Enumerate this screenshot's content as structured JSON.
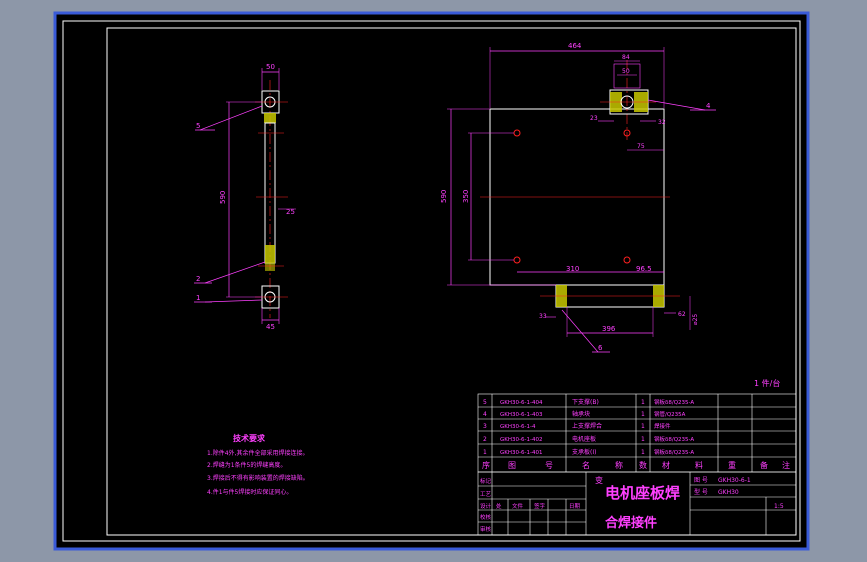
{
  "colors": {
    "background": "#8d97a8",
    "sheet": "#000000",
    "border": "#3a5bd8",
    "frame": "#ffffff",
    "dimension": "#ff40ff",
    "center_line": "#ff2020",
    "hatch": "#c8c800",
    "outline": "#ffffff"
  },
  "left_view": {
    "dim_top_width": "50",
    "dim_height": "590",
    "dim_mid": "25",
    "dim_bottom_width": "45",
    "callout_top": "5",
    "callout_mid": "2",
    "callout_bottom": "1"
  },
  "right_view": {
    "dim_total_width": "464",
    "dim_bracket_outer": "84",
    "dim_bracket_inner": "50",
    "dim_left_small": "23",
    "dim_right_small": "32",
    "dim_offset": "75",
    "dim_height_total": "590",
    "dim_hole_spacing_v": "350",
    "dim_hole_spacing_h": "310",
    "dim_hole_right": "96.5",
    "dim_bottom_left": "33",
    "dim_bottom_span": "396",
    "dim_bottom_right": "62",
    "dim_diameter": "⌀25",
    "callout_bracket": "4",
    "callout_bottom": "6"
  },
  "tech_notes": {
    "title": "技术要求",
    "lines": [
      "1.除件4外,其余件全部采用焊接连接。",
      "2.焊缝为1条件5的焊缝高度。",
      "3.焊接后不得有影响装置的焊接缺陷。",
      "4.件1与件5焊接时应保证同心。"
    ]
  },
  "quantity_note": "1 件/台",
  "bom": {
    "rows": [
      {
        "no": "5",
        "code": "GKH30-6-1-404",
        "name": "下支撑(B)",
        "qty": "1",
        "material": "钢板δ8/Q235-A"
      },
      {
        "no": "4",
        "code": "GKH30-6-1-403",
        "name": "轴承块",
        "qty": "1",
        "material": "钢管/Q235A"
      },
      {
        "no": "3",
        "code": "GKH30-6-1-4",
        "name": "上支撑焊合",
        "qty": "1",
        "material": "焊接件"
      },
      {
        "no": "2",
        "code": "GKH30-6-1-402",
        "name": "电机座板",
        "qty": "1",
        "material": "钢板δ8/Q235-A"
      },
      {
        "no": "1",
        "code": "GKH30-6-1-401",
        "name": "支承板(I)",
        "qty": "1",
        "material": "钢板δ8/Q235-A"
      }
    ],
    "header": [
      "序",
      "图",
      "号",
      "名",
      "称",
      "数",
      "材",
      "料",
      "重",
      "备",
      "注"
    ]
  },
  "title_block": {
    "main_title": "电机座板焊",
    "sub_title": "合焊接件",
    "drawing_no_label": "图 号",
    "drawing_no": "GKH30-6-1",
    "model_label": "型 号",
    "model": "GKH30",
    "scale": "1:5",
    "mark": "变",
    "left_labels": [
      "标记",
      "设计",
      "校核",
      "审核",
      "工艺"
    ],
    "mid_labels": [
      "处",
      "文件",
      "签字",
      "日期"
    ]
  }
}
